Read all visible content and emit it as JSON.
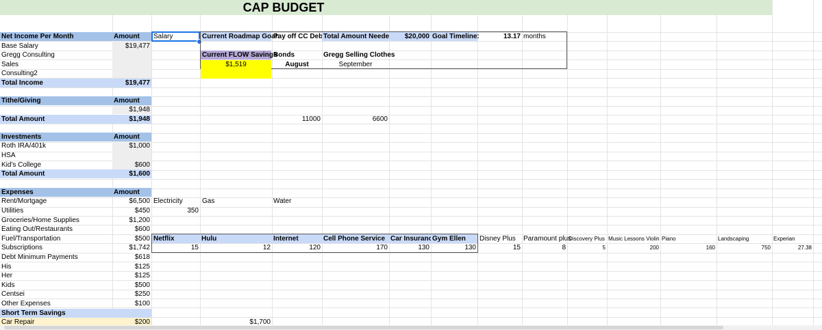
{
  "title": "CAP BUDGET",
  "income": {
    "header": "Net Income Per Month",
    "amount_label": "Amount",
    "rows": [
      {
        "label": "Base Salary",
        "value": "$19,477"
      },
      {
        "label": "Gregg Consulting",
        "value": ""
      },
      {
        "label": "Sales",
        "value": ""
      },
      {
        "label": "Consulting2",
        "value": ""
      }
    ],
    "total_label": "Total Income",
    "total_value": "$19,477"
  },
  "active_cell_text": "Salary",
  "goal": {
    "roadmap_label": "Current Roadmap Goal:",
    "roadmap_value": "Pay off CC Debt",
    "needed_label": "Total Amount Needed:",
    "needed_value": "$20,000",
    "timeline_label": "Goal Timeline:",
    "timeline_value": "13.17",
    "timeline_unit": "months",
    "flow_label": "Current FLOW Savings",
    "flow_value": "$1,519",
    "bonds_label": "Bonds",
    "bonds_month": "August",
    "gregg_label": "Gregg Selling Clothes",
    "gregg_month": "September"
  },
  "tithe": {
    "header": "Tithe/Giving",
    "amount_label": "Amount",
    "value": "$1,948",
    "total_label": "Total Amount",
    "total_value": "$1,948",
    "bonds_amount": "11000",
    "gregg_amount": "6600"
  },
  "investments": {
    "header": "Investments",
    "amount_label": "Amount",
    "rows": [
      {
        "label": "Roth IRA/401k",
        "value": "$1,000"
      },
      {
        "label": "HSA",
        "value": ""
      },
      {
        "label": "Kid's College",
        "value": "$600"
      }
    ],
    "total_label": "Total Amount",
    "total_value": "$1,600"
  },
  "expenses": {
    "header": "Expenses",
    "amount_label": "Amount",
    "rows": [
      {
        "label": "Rent/Mortgage",
        "value": "$6,500"
      },
      {
        "label": "Utilities",
        "value": "$450"
      },
      {
        "label": "Groceries/Home Supplies",
        "value": "$1,200"
      },
      {
        "label": "Eating Out/Restaurants",
        "value": "$600"
      },
      {
        "label": "Fuel/Transportation",
        "value": "$500"
      },
      {
        "label": "Subscriptions",
        "value": "$1,742"
      },
      {
        "label": "Debt Minimum Payments",
        "value": "$618"
      },
      {
        "label": "His",
        "value": "$125"
      },
      {
        "label": "Her",
        "value": "$125"
      },
      {
        "label": "Kids",
        "value": "$500"
      },
      {
        "label": "Centsei",
        "value": "$250"
      },
      {
        "label": "Other Expenses",
        "value": "$100"
      }
    ],
    "short_term_label": "Short Term Savings",
    "car_repair_label": "Car Repair",
    "car_repair_value": "$200",
    "car_repair_extra": "$1,700"
  },
  "utilities_detail": {
    "electricity": "Electricity",
    "electricity_value": "350",
    "gas": "Gas",
    "water": "Water"
  },
  "subscriptions_detail": {
    "netflix": "Netflix",
    "netflix_value": "15",
    "hulu": "Hulu",
    "hulu_value": "12",
    "internet": "Internet",
    "internet_value": "120",
    "cell": "Cell Phone Service",
    "cell_value": "170",
    "car_ins": "Car Insurance",
    "car_ins_value": "130",
    "gym": "Gym Ellen",
    "gym_value": "130",
    "disney": "Disney Plus",
    "disney_value": "15",
    "paramount": "Paramount plus",
    "paramount_value": "8",
    "discovery": "Discovery Plus",
    "discovery_value": "5",
    "violin": "Music Lessons Violin",
    "violin_value": "200",
    "piano": "Piano",
    "piano_value": "160",
    "landscaping": "Landscaping",
    "landscaping_value": "750",
    "experian": "Experian",
    "experian_value": "27.38"
  }
}
